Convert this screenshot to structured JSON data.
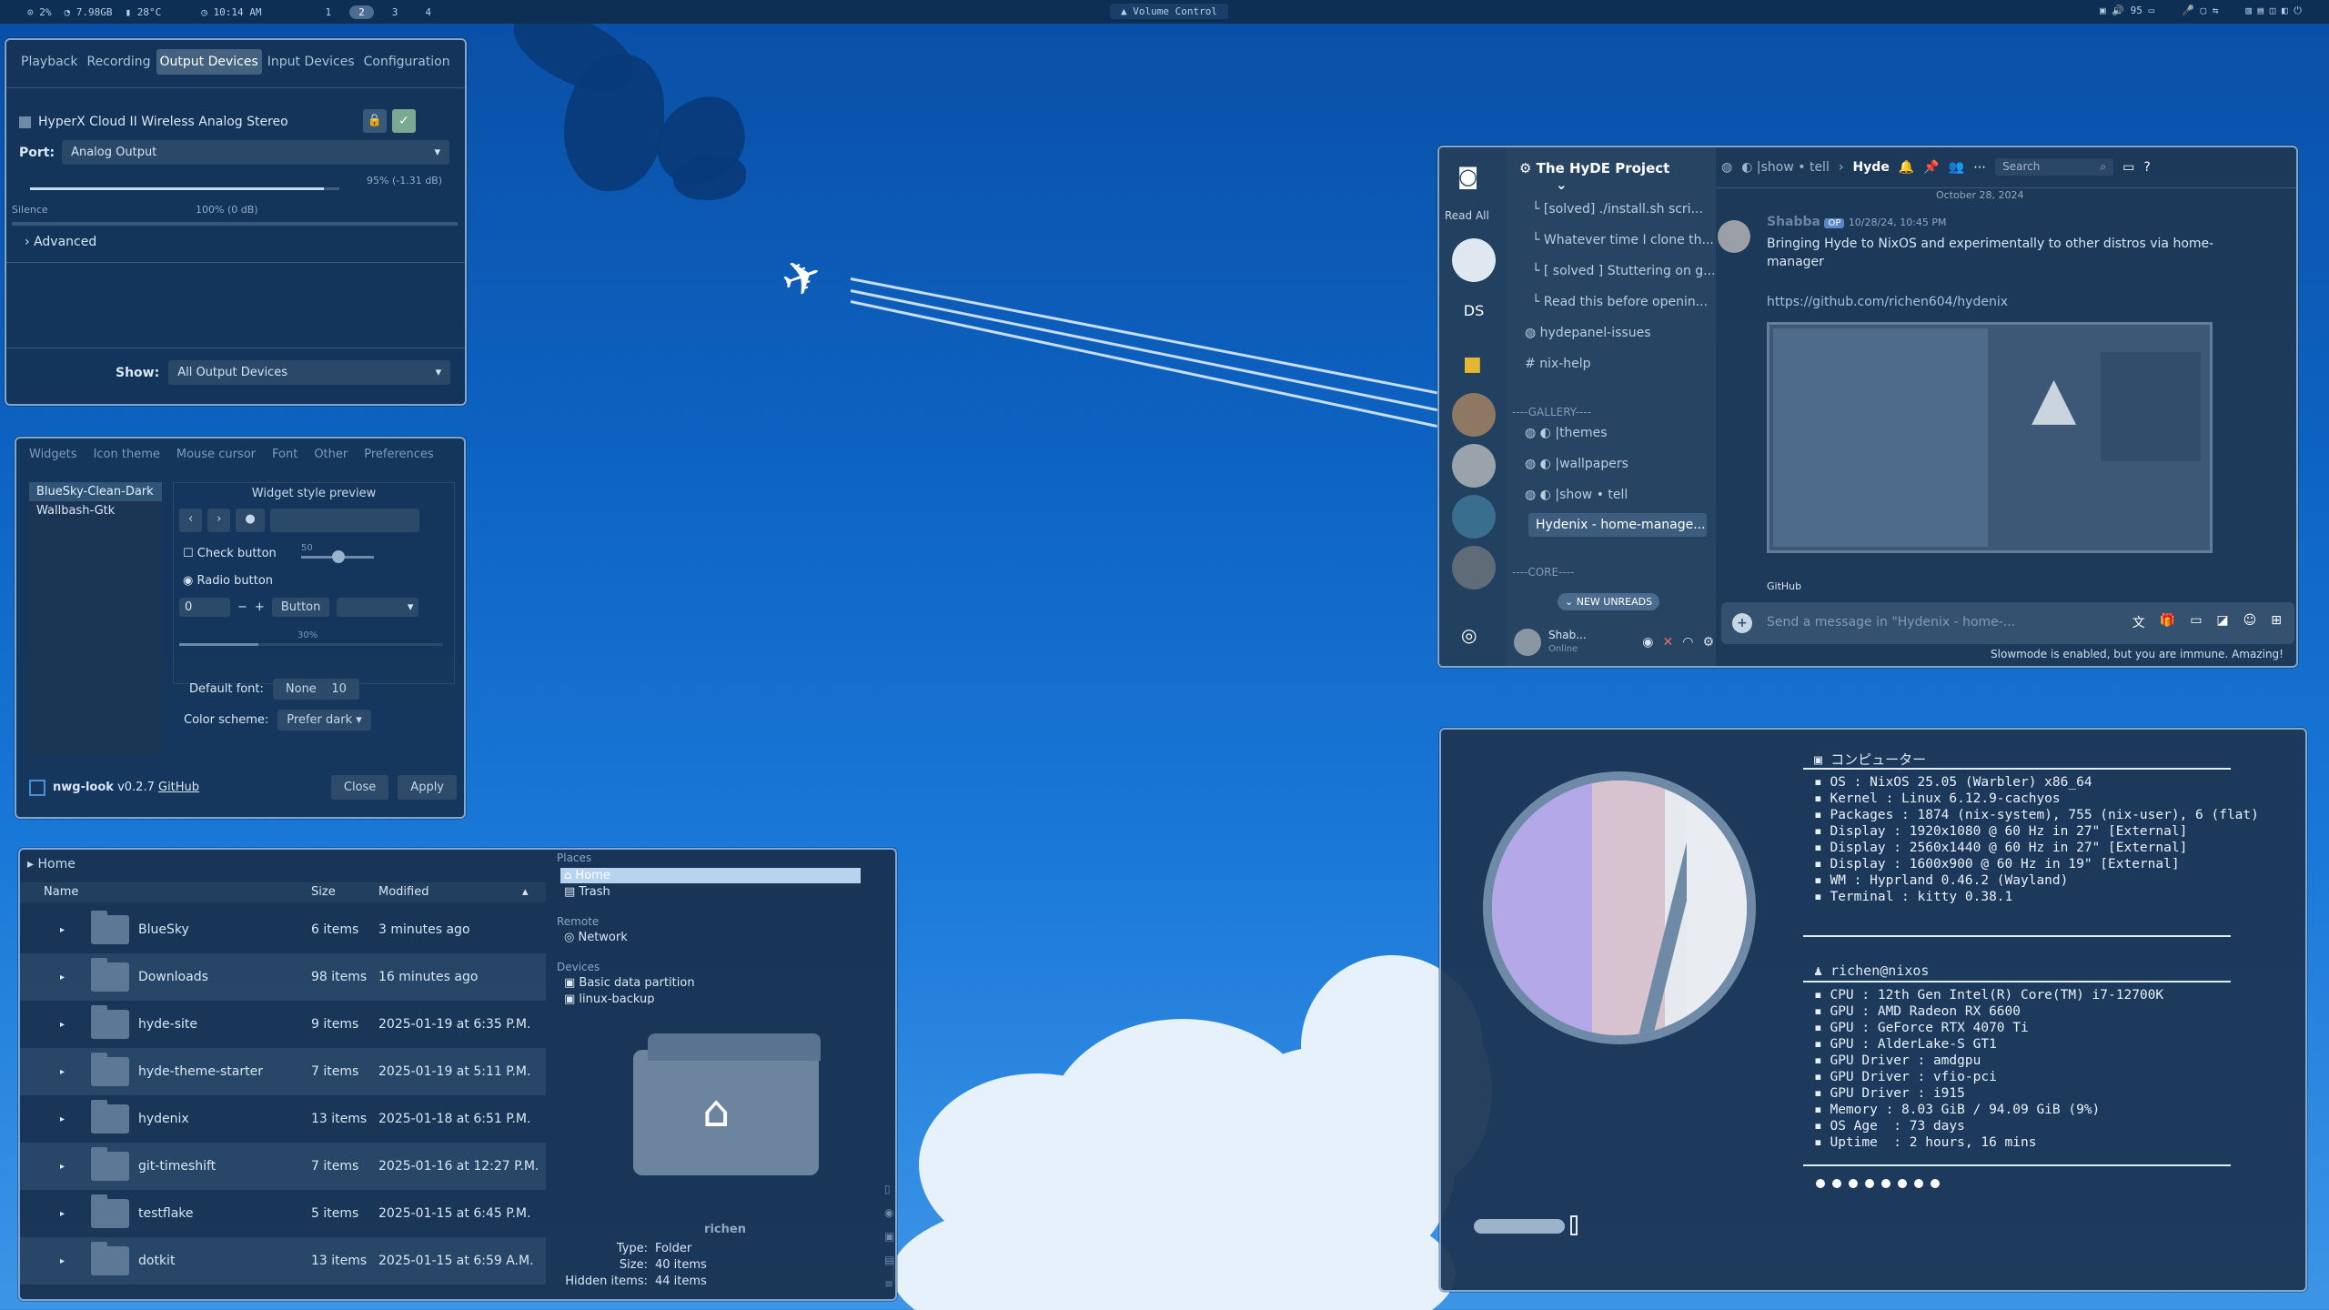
{
  "topbar": {
    "cpu": "2%",
    "mem": "7.98GB",
    "temp": "28°C",
    "clock": "10:14 AM",
    "workspaces": [
      "1",
      "2",
      "3",
      "4"
    ],
    "active_workspace": "2",
    "window_title": "Volume Control",
    "volume": "95"
  },
  "volume_control": {
    "tabs": [
      "Playback",
      "Recording",
      "Output Devices",
      "Input Devices",
      "Configuration"
    ],
    "active_tab": "Output Devices",
    "device_name": "HyperX Cloud II Wireless Analog Stereo",
    "port_label": "Port:",
    "port_value": "Analog Output",
    "level_text": "95% (-1.31 dB)",
    "level_fraction": 0.95,
    "scale_silence": "Silence",
    "scale_100": "100% (0 dB)",
    "advanced_label": "Advanced",
    "show_label": "Show:",
    "show_value": "All Output Devices"
  },
  "nwg_look": {
    "tabs": [
      "Widgets",
      "Icon theme",
      "Mouse cursor",
      "Font",
      "Other",
      "Preferences"
    ],
    "themes": [
      "BlueSky-Clean-Dark",
      "Wallbash-Gtk"
    ],
    "selected_theme": "BlueSky-Clean-Dark",
    "preview_title": "Widget style preview",
    "check_label": "Check button",
    "radio_label": "Radio button",
    "spin_value": "0",
    "spin_minus": "−",
    "spin_plus": "+",
    "button_label": "Button",
    "slider_value": "50",
    "progress_text": "30%",
    "progress_fraction": 0.3,
    "font_label": "Default font:",
    "font_name": "None",
    "font_size": "10",
    "scheme_label": "Color scheme:",
    "scheme_value": "Prefer dark",
    "app_name": "nwg-look",
    "version": "v0.2.7",
    "github": "GitHub",
    "close": "Close",
    "apply": "Apply"
  },
  "files": {
    "breadcrumb": "Home",
    "columns": [
      "Name",
      "Size",
      "Modified"
    ],
    "rows": [
      {
        "name": "BlueSky",
        "size": "6 items",
        "modified": "3 minutes ago"
      },
      {
        "name": "Downloads",
        "size": "98 items",
        "modified": "16 minutes ago"
      },
      {
        "name": "hyde-site",
        "size": "9 items",
        "modified": "2025-01-19 at 6:35 P.M."
      },
      {
        "name": "hyde-theme-starter",
        "size": "7 items",
        "modified": "2025-01-19 at 5:11 P.M."
      },
      {
        "name": "hydenix",
        "size": "13 items",
        "modified": "2025-01-18 at 6:51 P.M."
      },
      {
        "name": "git-timeshift",
        "size": "7 items",
        "modified": "2025-01-16 at 12:27 P.M."
      },
      {
        "name": "testflake",
        "size": "5 items",
        "modified": "2025-01-15 at 6:45 P.M."
      },
      {
        "name": "dotkit",
        "size": "13 items",
        "modified": "2025-01-15 at 6:59 A.M."
      }
    ],
    "places_title": "Places",
    "places": [
      "Home",
      "Trash"
    ],
    "remote_title": "Remote",
    "remote": [
      "Network"
    ],
    "devices_title": "Devices",
    "devices": [
      "Basic data partition",
      "linux-backup"
    ],
    "info_name": "richen",
    "info_type_label": "Type:",
    "info_type": "Folder",
    "info_size_label": "Size:",
    "info_size": "40 items",
    "info_hidden_label": "Hidden items:",
    "info_hidden": "44 items"
  },
  "discord": {
    "read_all": "Read All",
    "server_abbrev": "DS",
    "server_name": "The HyDE Project",
    "channels": [
      "[solved] ./install.sh scri...",
      "Whatever time I clone th...",
      "[ solved ] Stuttering on g...",
      "Read this before openin...",
      "hydepanel-issues",
      "nix-help"
    ],
    "gallery_header": "----GALLERY----",
    "gallery": [
      "themes",
      "wallpapers",
      "show • tell"
    ],
    "thread": "Hydenix - home-manage...",
    "core_header": "----CORE----",
    "new_unreads": "NEW UNREADS",
    "user_name": "Shab...",
    "user_status": "Online",
    "crumb_channel": "show • tell",
    "crumb_thread": "Hyde",
    "search": "Search",
    "date_divider": "October 28, 2024",
    "author": "Shabba",
    "op_badge": "OP",
    "timestamp": "10/28/24, 10:45 PM",
    "message": "Bringing Hyde to NixOS and experimentally to other distros via home-manager",
    "link": "https://github.com/richen604/hydenix",
    "embed_source": "GitHub",
    "input_placeholder": "Send a message in \"Hydenix - home-...",
    "slowmode": "Slowmode is enabled, but you are immune. Amazing!"
  },
  "fastfetch": {
    "host_header": "コンピューター",
    "sys_lines": [
      "OS : NixOS 25.05 (Warbler) x86_64",
      "Kernel : Linux 6.12.9-cachyos",
      "Packages : 1874 (nix-system), 755 (nix-user), 6 (flat)",
      "Display : 1920x1080 @ 60 Hz in 27\" [External]",
      "Display : 2560x1440 @ 60 Hz in 27\" [External]",
      "Display : 1600x900 @ 60 Hz in 19\" [External]",
      "WM : Hyprland 0.46.2 (Wayland)",
      "Terminal : kitty 0.38.1"
    ],
    "user_header": "richen@nixos",
    "hw_lines": [
      "CPU : 12th Gen Intel(R) Core(TM) i7-12700K",
      "GPU : AMD Radeon RX 6600",
      "GPU : GeForce RTX 4070 Ti",
      "GPU : AlderLake-S GT1",
      "GPU Driver : amdgpu",
      "GPU Driver : vfio-pci",
      "GPU Driver : i915",
      "Memory : 8.03 GiB / 94.09 GiB (9%)",
      "OS Age  : 73 days",
      "Uptime  : 2 hours, 16 mins"
    ],
    "palette": [
      "#ffffff",
      "#ffffff",
      "#ffffff",
      "#ffffff",
      "#ffffff",
      "#ffffff",
      "#ffffff",
      "#ffffff"
    ]
  }
}
